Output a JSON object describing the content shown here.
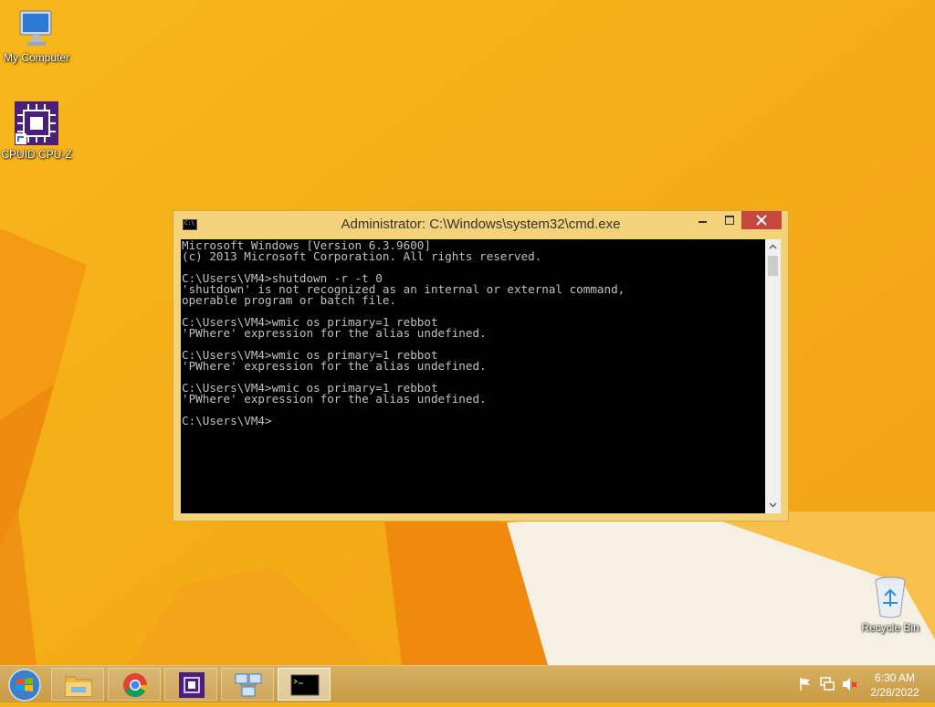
{
  "desktop": {
    "icons": [
      {
        "label": "My Computer",
        "icon": "computer-icon"
      },
      {
        "label": "CPUID CPU-Z",
        "icon": "cpuz-icon"
      },
      {
        "label": "Recycle Bin",
        "icon": "recycle-bin-icon"
      }
    ]
  },
  "cmd_window": {
    "title": "Administrator: C:\\Windows\\system32\\cmd.exe",
    "icon_text": "C:\\",
    "lines": [
      "Microsoft Windows [Version 6.3.9600]",
      "(c) 2013 Microsoft Corporation. All rights reserved.",
      "",
      "C:\\Users\\VM4>shutdown -r -t 0",
      "'shutdown' is not recognized as an internal or external command,",
      "operable program or batch file.",
      "",
      "C:\\Users\\VM4>wmic os primary=1 rebbot",
      "'PWhere' expression for the alias undefined.",
      "",
      "C:\\Users\\VM4>wmic os primary=1 rebbot",
      "'PWhere' expression for the alias undefined.",
      "",
      "C:\\Users\\VM4>wmic os primary=1 rebbot",
      "'PWhere' expression for the alias undefined.",
      "",
      "C:\\Users\\VM4>"
    ]
  },
  "taskbar": {
    "buttons": [
      {
        "name": "file-explorer",
        "icon": "folder-icon"
      },
      {
        "name": "chrome",
        "icon": "chrome-icon"
      },
      {
        "name": "cpuz",
        "icon": "cpuz-icon"
      },
      {
        "name": "network",
        "icon": "network-icon"
      },
      {
        "name": "cmd",
        "icon": "cmd-icon",
        "active": true
      }
    ],
    "tray_icons": [
      "flag-icon",
      "network-icon",
      "speaker-muted-icon"
    ],
    "clock": {
      "time": "6:30 AM",
      "date": "2/28/2022"
    }
  },
  "colors": {
    "wallpaper": "#f6b21a",
    "window_frame": "#f3d27a",
    "close_button": "#c7473d",
    "console_bg": "#000000",
    "console_text": "#c0c0c0"
  }
}
